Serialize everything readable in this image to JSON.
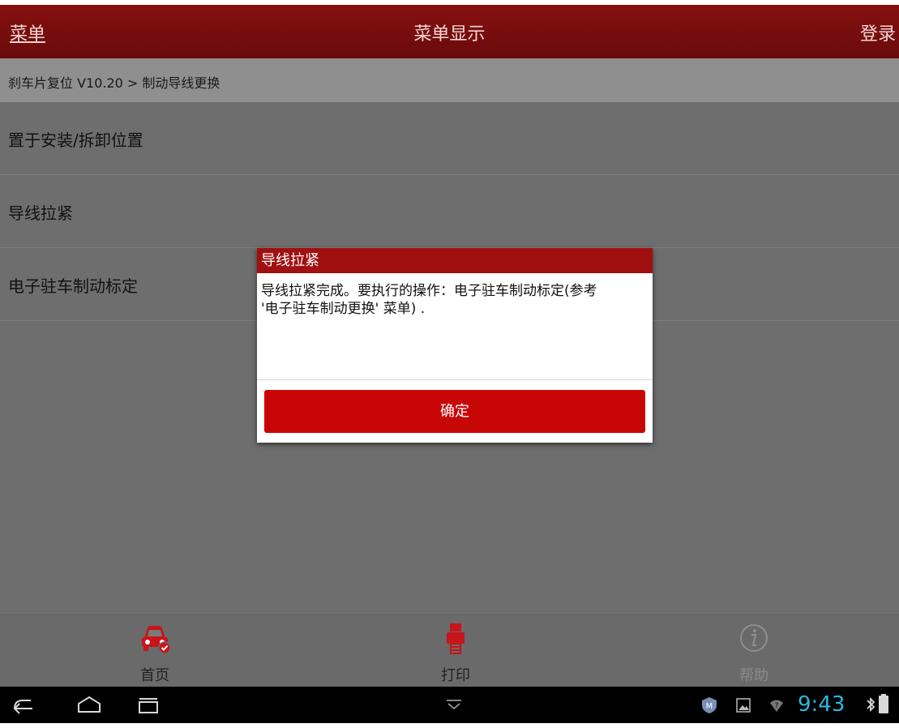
{
  "header": {
    "menu_link": "菜单",
    "title": "菜单显示",
    "login_link": "登录"
  },
  "breadcrumb": "刹车片复位 V10.20 > 制动导线更换",
  "menu_items": [
    {
      "label": "置于安装/拆卸位置"
    },
    {
      "label": "导线拉紧"
    },
    {
      "label": "电子驻车制动标定"
    }
  ],
  "dialog": {
    "title": "导线拉紧",
    "message_line1": "导线拉紧完成。要执行的操作：电子驻车制动标定(参考",
    "message_line2": "'电子驻车制动更换' 菜单) .",
    "confirm_label": "确定"
  },
  "toolbar": {
    "home": {
      "label": "首页",
      "icon": "car-icon"
    },
    "print": {
      "label": "打印",
      "icon": "printer-icon"
    },
    "help": {
      "label": "帮助",
      "icon": "info-icon"
    }
  },
  "statusbar": {
    "time": "9:43"
  },
  "colors": {
    "header_bg": "#7a0d0d",
    "accent_red": "#c90606",
    "clock_blue": "#2ab8e0"
  }
}
